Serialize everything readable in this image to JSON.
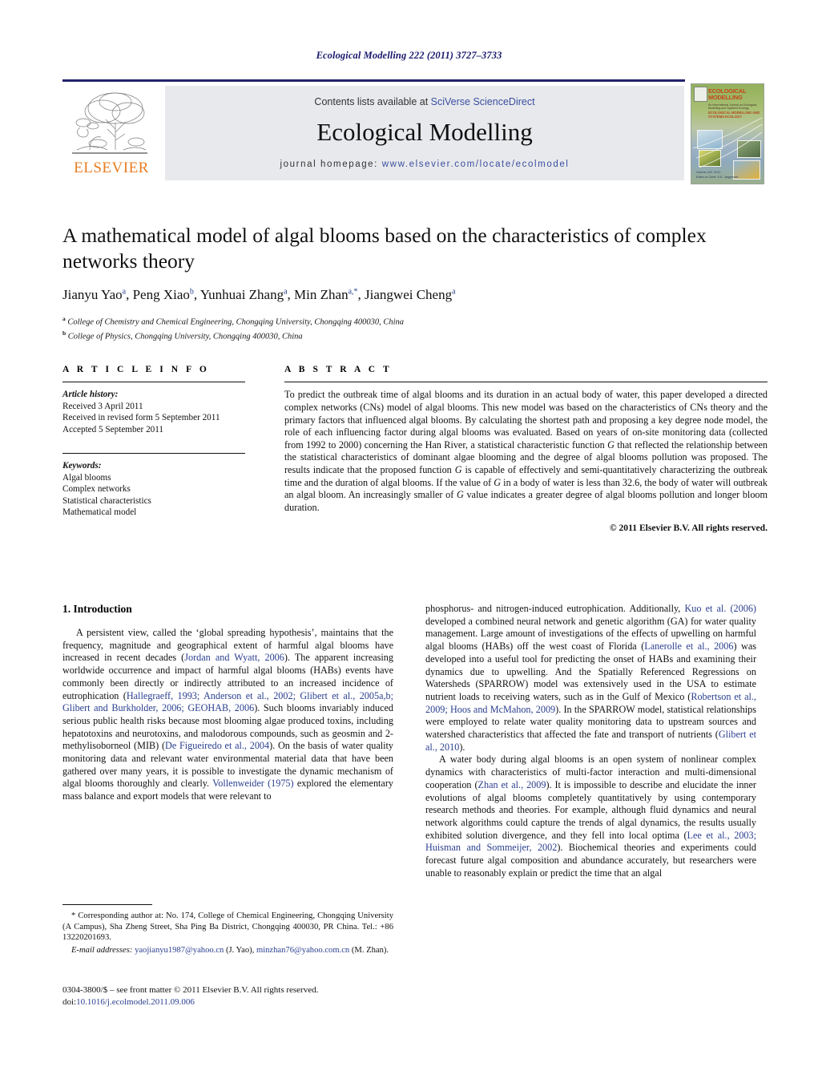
{
  "running_head": "Ecological Modelling 222 (2011) 3727–3733",
  "masthead": {
    "contents_prefix": "Contents lists available at ",
    "sciencedirect": "SciVerse ScienceDirect",
    "journal_title": "Ecological Modelling",
    "homepage_prefix": "journal homepage: ",
    "homepage_url": "www.elsevier.com/locate/ecolmodel",
    "publisher_wordmark": "ELSEVIER",
    "accent_orange": "#e87d22",
    "accent_blue": "#3a4fa0",
    "banner_bg": "#e8e9ec"
  },
  "cover": {
    "title_line": "ECOLOGICAL MODELLING",
    "subtitle": "An International Journal on Ecological Modelling and Systems Ecology",
    "subtitle2": "ECOLOGICAL MODELLING AND SYSTEMS ECOLOGY",
    "footer_line1": "Volume 222, 2011",
    "footer_line2": "Editor-in-Chief: S.E. Jørgensen"
  },
  "article": {
    "title": "A mathematical model of algal blooms based on the characteristics of complex networks theory",
    "authors": [
      {
        "name": "Jianyu Yao",
        "marks": "a"
      },
      {
        "name": "Peng Xiao",
        "marks": "b"
      },
      {
        "name": "Yunhuai Zhang",
        "marks": "a"
      },
      {
        "name": "Min Zhan",
        "marks": "a,*"
      },
      {
        "name": "Jiangwei Cheng",
        "marks": "a"
      }
    ],
    "affiliations": [
      {
        "mark": "a",
        "text": "College of Chemistry and Chemical Engineering, Chongqing University, Chongqing 400030, China"
      },
      {
        "mark": "b",
        "text": "College of Physics, Chongqing University, Chongqing 400030, China"
      }
    ]
  },
  "article_info": {
    "label": "A R T I C L E   I N F O",
    "history_label": "Article history:",
    "history": [
      "Received 3 April 2011",
      "Received in revised form 5 September 2011",
      "Accepted 5 September 2011"
    ],
    "keywords_label": "Keywords:",
    "keywords": [
      "Algal blooms",
      "Complex networks",
      "Statistical characteristics",
      "Mathematical model"
    ]
  },
  "abstract": {
    "label": "A B S T R A C T",
    "text_part1": "To predict the outbreak time of algal blooms and its duration in an actual body of water, this paper developed a directed complex networks (CNs) model of algal blooms. This new model was based on the characteristics of CNs theory and the primary factors that influenced algal blooms. By calculating the shortest path and proposing a key degree node model, the role of each influencing factor during algal blooms was evaluated. Based on years of on-site monitoring data (collected from 1992 to 2000) concerning the Han River, a statistical characteristic function ",
    "g1": "G",
    "text_part2": " that reflected the relationship between the statistical characteristics of dominant algae blooming and the degree of algal blooms pollution was proposed. The results indicate that the proposed function ",
    "g2": "G",
    "text_part3": " is capable of effectively and semi-quantitatively characterizing the outbreak time and the duration of algal blooms. If the value of ",
    "g3": "G",
    "text_part4": " in a body of water is less than 32.6, the body of water will outbreak an algal bloom. An increasingly smaller of ",
    "g4": "G",
    "text_part5": " value indicates a greater degree of algal blooms pollution and longer bloom duration.",
    "copyright": "© 2011 Elsevier B.V. All rights reserved."
  },
  "body": {
    "section_heading": "1.  Introduction",
    "left_p1_a": "A persistent view, called the ‘global spreading hypothesis’, maintains that the frequency, magnitude and geographical extent of harmful algal blooms have increased in recent decades (",
    "left_cite1": "Jordan and Wyatt, 2006",
    "left_p1_b": "). The apparent increasing worldwide occurrence and impact of harmful algal blooms (HABs) events have commonly been directly or indirectly attributed to an increased incidence of eutrophication (",
    "left_cite2": "Hallegraeff, 1993; Anderson et al., 2002; Glibert et al., 2005a,b; Glibert and Burkholder, 2006; GEOHAB, 2006",
    "left_p1_c": "). Such blooms invariably induced serious public health risks because most blooming algae produced toxins, including hepatotoxins and neurotoxins, and malodorous compounds, such as geosmin and 2-methylisoborneol (MIB) (",
    "left_cite3": "De Figueiredo et al., 2004",
    "left_p1_d": "). On the basis of water quality monitoring data and relevant water environmental material data that have been gathered over many years, it is possible to investigate the dynamic mechanism of algal blooms thoroughly and clearly. ",
    "left_cite4": "Vollenweider (1975)",
    "left_p1_e": " explored the elementary mass balance and export models that were relevant to",
    "right_p1_a": "phosphorus- and nitrogen-induced eutrophication. Additionally, ",
    "right_cite1": "Kuo et al. (2006)",
    "right_p1_b": " developed a combined neural network and genetic algorithm (GA) for water quality management. Large amount of investigations of the effects of upwelling on harmful algal blooms (HABs) off the west coast of Florida (",
    "right_cite2": "Lanerolle et al., 2006",
    "right_p1_c": ") was developed into a useful tool for predicting the onset of HABs and examining their dynamics due to upwelling. And the Spatially Referenced Regressions on Watersheds (SPARROW) model was extensively used in the USA to estimate nutrient loads to receiving waters, such as in the Gulf of Mexico (",
    "right_cite3": "Robertson et al., 2009; Hoos and McMahon, 2009",
    "right_p1_d": "). In the SPARROW model, statistical relationships were employed to relate water quality monitoring data to upstream sources and watershed characteristics that affected the fate and transport of nutrients (",
    "right_cite4": "Glibert et al., 2010",
    "right_p1_e": ").",
    "right_p2_a": "A water body during algal blooms is an open system of nonlinear complex dynamics with characteristics of multi-factor interaction and multi-dimensional cooperation (",
    "right_cite5": "Zhan et al., 2009",
    "right_p2_b": "). It is impossible to describe and elucidate the inner evolutions of algal blooms completely quantitatively by using contemporary research methods and theories. For example, although fluid dynamics and neural network algorithms could capture the trends of algal dynamics, the results usually exhibited solution divergence, and they fell into local optima (",
    "right_cite6": "Lee et al., 2003; Huisman and Sommeijer, 2002",
    "right_p2_c": "). Biochemical theories and experiments could forecast future algal composition and abundance accurately, but researchers were unable to reasonably explain or predict the time that an algal"
  },
  "footnote": {
    "corresponding": "* Corresponding author at: No. 174, College of Chemical Engineering, Chongqing University (A Campus), Sha Zheng Street, Sha Ping Ba District, Chongqing 400030, PR China. Tel.: +86 13220201693.",
    "email_label": "E-mail addresses:",
    "email1": "yaojianyu1987@yahoo.cn",
    "email1_owner": " (J. Yao), ",
    "email2": "minzhan76@yahoo.com.cn",
    "email2_owner": " (M. Zhan)."
  },
  "imprint": {
    "line1": "0304-3800/$ – see front matter © 2011 Elsevier B.V. All rights reserved.",
    "doi_prefix": "doi:",
    "doi": "10.1016/j.ecolmodel.2011.09.006"
  }
}
